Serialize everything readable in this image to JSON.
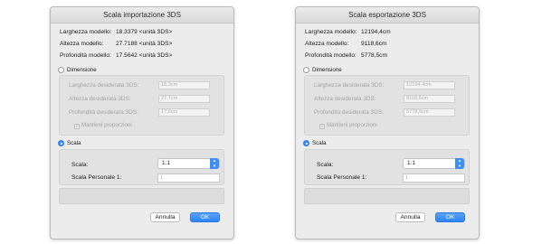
{
  "dialogs": [
    {
      "title": "Scala importazione 3DS",
      "info": [
        {
          "label": "Larghezza modello:",
          "value": "18.3379 <unità 3DS>"
        },
        {
          "label": "Altezza modello:",
          "value": "27.7188 <unità 3DS>"
        },
        {
          "label": "Profondità modello:",
          "value": "17.5642 <unità 3DS>"
        }
      ],
      "dimension_option": {
        "label": "Dimensione",
        "selected": false,
        "width_label": "Larghezza desiderata 3DS:",
        "width_value": "18,3cm",
        "height_label": "Altezza desiderata 3DS:",
        "height_value": "27,7cm",
        "depth_label": "Profondità desiderata 3DS:",
        "depth_value": "17,6cm",
        "keep_proportions_label": "Mantieni proporzioni",
        "keep_proportions_checked": true
      },
      "scale_option": {
        "label": "Scala",
        "selected": true,
        "scale_label": "Scala:",
        "scale_value": "1:1",
        "custom_label": "Scala Personale  1:",
        "custom_value": "1"
      },
      "cancel_label": "Annulla",
      "ok_label": "OK"
    },
    {
      "title": "Scala esportazione 3DS",
      "info": [
        {
          "label": "Larghezza modello:",
          "value": "12194,4cm"
        },
        {
          "label": "Altezza modello:",
          "value": "9118,6cm"
        },
        {
          "label": "Profondità modello:",
          "value": "5778,5cm"
        }
      ],
      "dimension_option": {
        "label": "Dimensione",
        "selected": false,
        "width_label": "Larghezza desiderata 3DS:",
        "width_value": "12194,4cm",
        "height_label": "Altezza desiderata 3DS:",
        "height_value": "9118,6cm",
        "depth_label": "Profondità desiderata 3DS:",
        "depth_value": "5778,5cm",
        "keep_proportions_label": "Mantieni proporzioni",
        "keep_proportions_checked": true
      },
      "scale_option": {
        "label": "Scala",
        "selected": true,
        "scale_label": "Scala:",
        "scale_value": "1:1",
        "custom_label": "Scala Personale  1:",
        "custom_value": "1"
      },
      "cancel_label": "Annulla",
      "ok_label": "OK"
    }
  ],
  "colors": {
    "accent": "#3b8ff7",
    "dialog_bg": "#ececec",
    "section_bg": "#e2e2e2",
    "disabled_text": "#a4a4a4"
  },
  "icons": {
    "stepper": "up-down-chevron-icon",
    "check": "checkmark-icon"
  }
}
